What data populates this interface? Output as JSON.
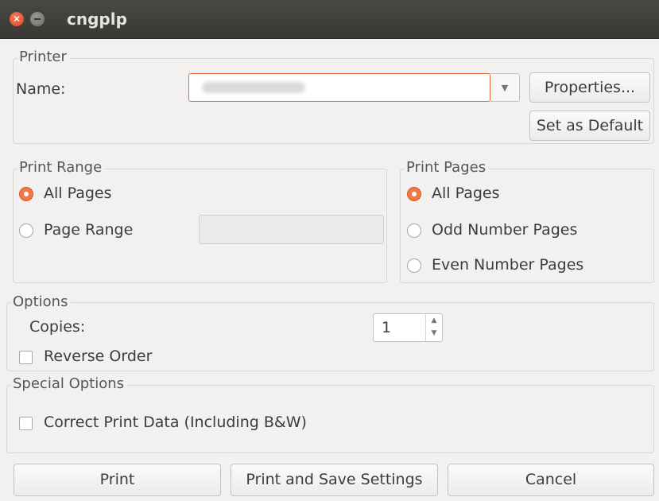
{
  "window": {
    "title": "cngplp"
  },
  "printer": {
    "group_label": "Printer",
    "name_label": "Name:",
    "properties_label": "Properties...",
    "set_default_label": "Set as Default"
  },
  "print_range": {
    "group_label": "Print Range",
    "all_pages_label": "All Pages",
    "page_range_label": "Page Range",
    "selected": "All Pages"
  },
  "print_pages": {
    "group_label": "Print Pages",
    "all_label": "All Pages",
    "odd_label": "Odd Number Pages",
    "even_label": "Even Number Pages",
    "selected": "All Pages"
  },
  "options": {
    "group_label": "Options",
    "copies_label": "Copies:",
    "copies_value": "1",
    "reverse_order_label": "Reverse Order",
    "reverse_order_checked": false
  },
  "special_options": {
    "group_label": "Special Options",
    "correct_print_label": "Correct Print Data (Including B&W)",
    "correct_print_checked": false
  },
  "buttons": {
    "print": "Print",
    "print_save": "Print and Save Settings",
    "cancel": "Cancel"
  },
  "colors": {
    "accent": "#f07746",
    "titlebar": "#3c3b37",
    "window_bg": "#f2f1f0"
  }
}
